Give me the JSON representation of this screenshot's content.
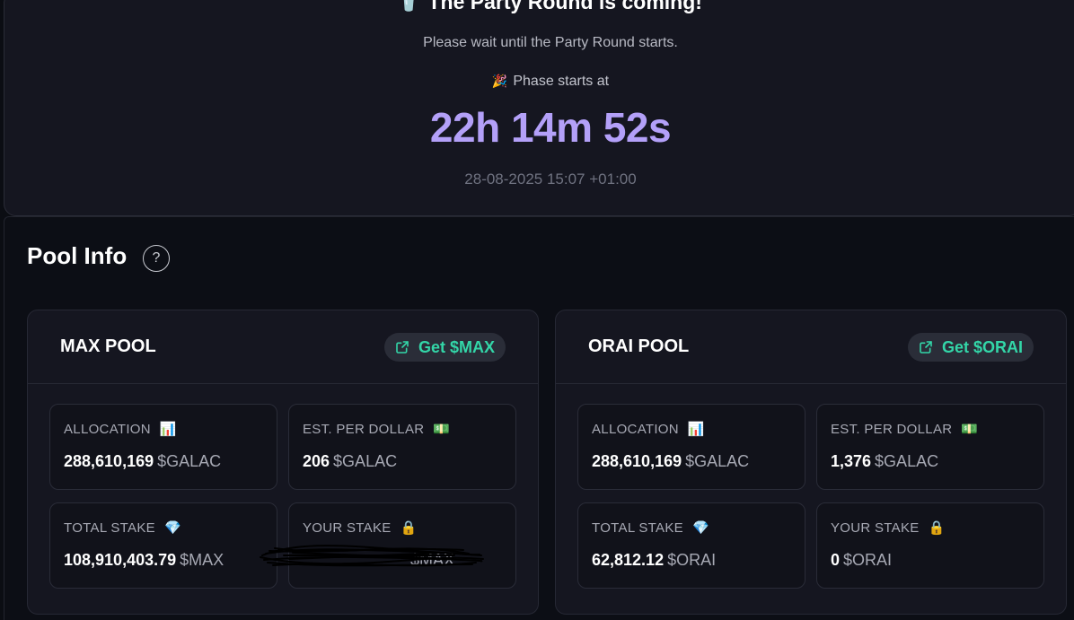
{
  "hero": {
    "title_emoji": "🥤",
    "title": "The Party Round is coming!",
    "subtitle": "Please wait until the Party Round starts.",
    "phase_emoji": "🎉",
    "phase_label": "Phase starts at",
    "countdown": "22h 14m 52s",
    "datetime": "28-08-2025 15:07 +01:00"
  },
  "pool_info": {
    "title": "Pool Info",
    "help": "?"
  },
  "pools": [
    {
      "name": "MAX POOL",
      "get_label": "Get $MAX",
      "allocation": {
        "label": "ALLOCATION",
        "emoji": "📊",
        "value": "288,610,169",
        "unit": "$GALAC"
      },
      "per_dollar": {
        "label": "EST. PER DOLLAR",
        "emoji": "💵",
        "value": "206",
        "unit": "$GALAC"
      },
      "total_stake": {
        "label": "TOTAL STAKE",
        "emoji": "💎",
        "value": "108,910,403.79",
        "unit": "$MAX"
      },
      "your_stake": {
        "label": "YOUR STAKE",
        "emoji": "🔒",
        "value": "",
        "unit": "$MAX",
        "redacted": true
      }
    },
    {
      "name": "ORAI POOL",
      "get_label": "Get $ORAI",
      "allocation": {
        "label": "ALLOCATION",
        "emoji": "📊",
        "value": "288,610,169",
        "unit": "$GALAC"
      },
      "per_dollar": {
        "label": "EST. PER DOLLAR",
        "emoji": "💵",
        "value": "1,376",
        "unit": "$GALAC"
      },
      "total_stake": {
        "label": "TOTAL STAKE",
        "emoji": "💎",
        "value": "62,812.12",
        "unit": "$ORAI"
      },
      "your_stake": {
        "label": "YOUR STAKE",
        "emoji": "🔒",
        "value": "0",
        "unit": "$ORAI"
      }
    }
  ],
  "colors": {
    "accent_countdown": "#b3a0f8",
    "accent_green": "#33d6a8"
  },
  "icons": {
    "external_link": "external-link-icon",
    "help": "question-circle-icon"
  }
}
